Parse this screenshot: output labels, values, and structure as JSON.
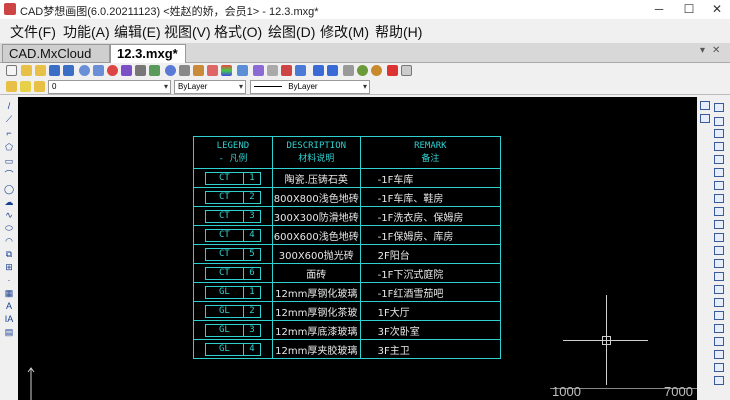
{
  "window": {
    "title": "CAD梦想画图(6.0.20211123) <姓赵的娇，会员1> - 12.3.mxg*",
    "minimize": "─",
    "maximize": "☐",
    "close": "✕"
  },
  "menu": [
    "文件(F)",
    "功能(A)",
    "编辑(E)",
    "视图(V)",
    "格式(O)",
    "绘图(D)",
    "修改(M)",
    "帮助(H)"
  ],
  "tabs": [
    {
      "label": "CAD.MxCloud"
    },
    {
      "label": "12.3.mxg*"
    }
  ],
  "toolbar2": {
    "layer": "0",
    "color": "ByLayer",
    "linetype": "ByLayer"
  },
  "legend": {
    "header": {
      "col1_line1": "LEGEND",
      "col1_line2": "- 凡例",
      "col2_line1": "DESCRIPTION",
      "col2_line2": "材料说明",
      "col3_line1": "REMARK",
      "col3_line2": "备注"
    },
    "rows": [
      {
        "code": "CT",
        "num": "1",
        "desc": "陶瓷.压铸石英",
        "remark": "-1F车库"
      },
      {
        "code": "CT",
        "num": "2",
        "desc": "800X800浅色地砖",
        "remark": "-1F车库、鞋房"
      },
      {
        "code": "CT",
        "num": "3",
        "desc": "300X300防滑地砖",
        "remark": "-1F洗衣房、保姆房"
      },
      {
        "code": "CT",
        "num": "4",
        "desc": "600X600浅色地砖",
        "remark": "-1F保姆房、库房"
      },
      {
        "code": "CT",
        "num": "5",
        "desc": "300X600抛光砖",
        "remark": "2F阳台"
      },
      {
        "code": "CT",
        "num": "6",
        "desc": "面砖",
        "remark": "-1F下沉式庭院"
      },
      {
        "code": "GL",
        "num": "1",
        "desc": "12mm厚钢化玻璃",
        "remark": "-1F红酒雪茄吧"
      },
      {
        "code": "GL",
        "num": "2",
        "desc": "12mm厚钢化茶玻",
        "remark": "1F大厅"
      },
      {
        "code": "GL",
        "num": "3",
        "desc": "12mm厚底漆玻璃",
        "remark": "3F次卧室"
      },
      {
        "code": "GL",
        "num": "4",
        "desc": "12mm厚夹胶玻璃",
        "remark": "3F主卫"
      }
    ]
  },
  "ruler": {
    "left_label": "1000",
    "right_label": "7000"
  },
  "colors": {
    "canvas_bg": "#000000",
    "table_line": "#2fd0d0",
    "text_white": "#e8e8e8"
  }
}
